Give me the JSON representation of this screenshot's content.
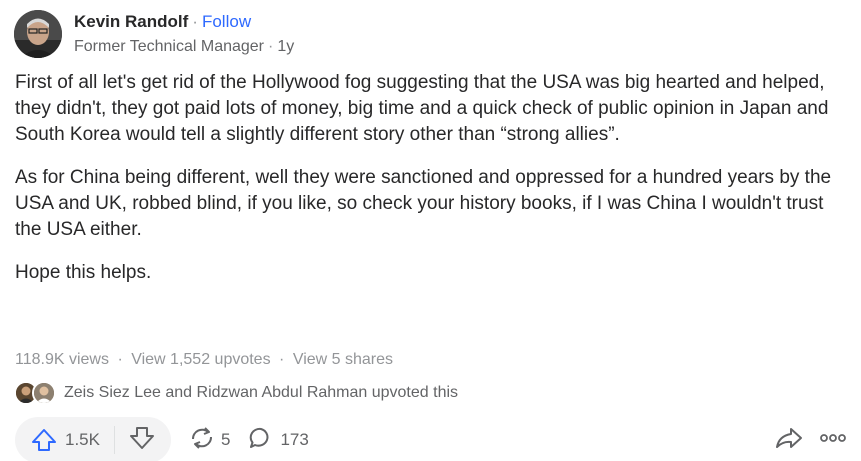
{
  "author": {
    "name": "Kevin Randolf",
    "follow_label": "Follow",
    "credential": "Former Technical Manager",
    "age": "1y",
    "separator": "·"
  },
  "answer": {
    "paragraphs": [
      "First of all let's get rid of the Hollywood fog suggesting that the USA was big hearted and helped, they didn't, they got paid lots of money, big time and a quick check of public opinion in Japan and South Korea would tell a slightly different story other than “strong allies”.",
      "As for China being different, well they were sanctioned and oppressed for a hundred years by the USA and UK, robbed blind, if you like, so check your history books, if I was China I wouldn't trust the USA either.",
      "Hope this helps."
    ]
  },
  "stats": {
    "views": "118.9K views",
    "upvotes": "View 1,552 upvotes",
    "shares": "View 5 shares",
    "separator": "·"
  },
  "upvoted_by": {
    "text": "Zeis Siez Lee and Ridzwan Abdul Rahman upvoted this"
  },
  "actions": {
    "upvote_count": "1.5K",
    "share_count": "5",
    "comment_count": "173"
  },
  "colors": {
    "accent": "#2e69ff",
    "text": "#282829",
    "muted": "#939598",
    "icon": "#636466"
  }
}
